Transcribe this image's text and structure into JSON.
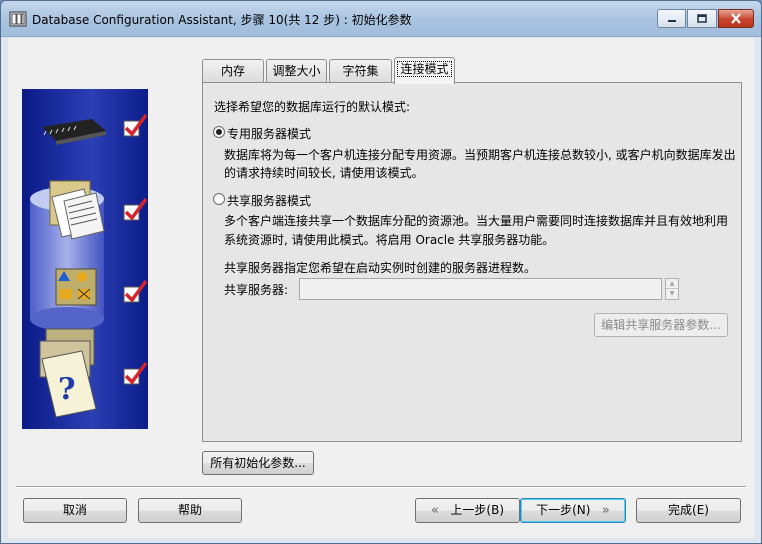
{
  "window": {
    "title": "Database Configuration Assistant, 步骤 10(共 12 步) : 初始化参数"
  },
  "tabs": [
    {
      "label": "内存",
      "active": false
    },
    {
      "label": "调整大小",
      "active": false
    },
    {
      "label": "字符集",
      "active": false
    },
    {
      "label": "连接模式",
      "active": true
    }
  ],
  "panel": {
    "prompt": "选择希望您的数据库运行的默认模式:",
    "dedicated": {
      "label": "专用服务器模式",
      "checked": true,
      "desc_line1": "数据库将为每一个客户机连接分配专用资源。当预期客户机连接总数较小, 或客户机向数据库发出",
      "desc_line2": "的请求持续时间较长, 请使用该模式。"
    },
    "shared": {
      "label": "共享服务器模式",
      "checked": false,
      "desc_line1": "多个客户端连接共享一个数据库分配的资源池。当大量用户需要同时连接数据库并且有效地利用",
      "desc_line2": "系统资源时, 请使用此模式。将启用 Oracle 共享服务器功能。"
    },
    "shared_count_desc": "共享服务器指定您希望在启动实例时创建的服务器进程数。",
    "shared_servers_label": "共享服务器:",
    "shared_servers_value": "",
    "edit_shared_params_button": "编辑共享服务器参数..."
  },
  "all_init_params_button": "所有初始化参数...",
  "footer": {
    "cancel": "取消",
    "help": "帮助",
    "back": "上一步(B)",
    "next": "下一步(N)",
    "finish": "完成(E)"
  },
  "colors": {
    "titlebar": "#a9c3e0",
    "sidebar_blue": "#1d2fa0",
    "check_red": "#d8232a"
  }
}
